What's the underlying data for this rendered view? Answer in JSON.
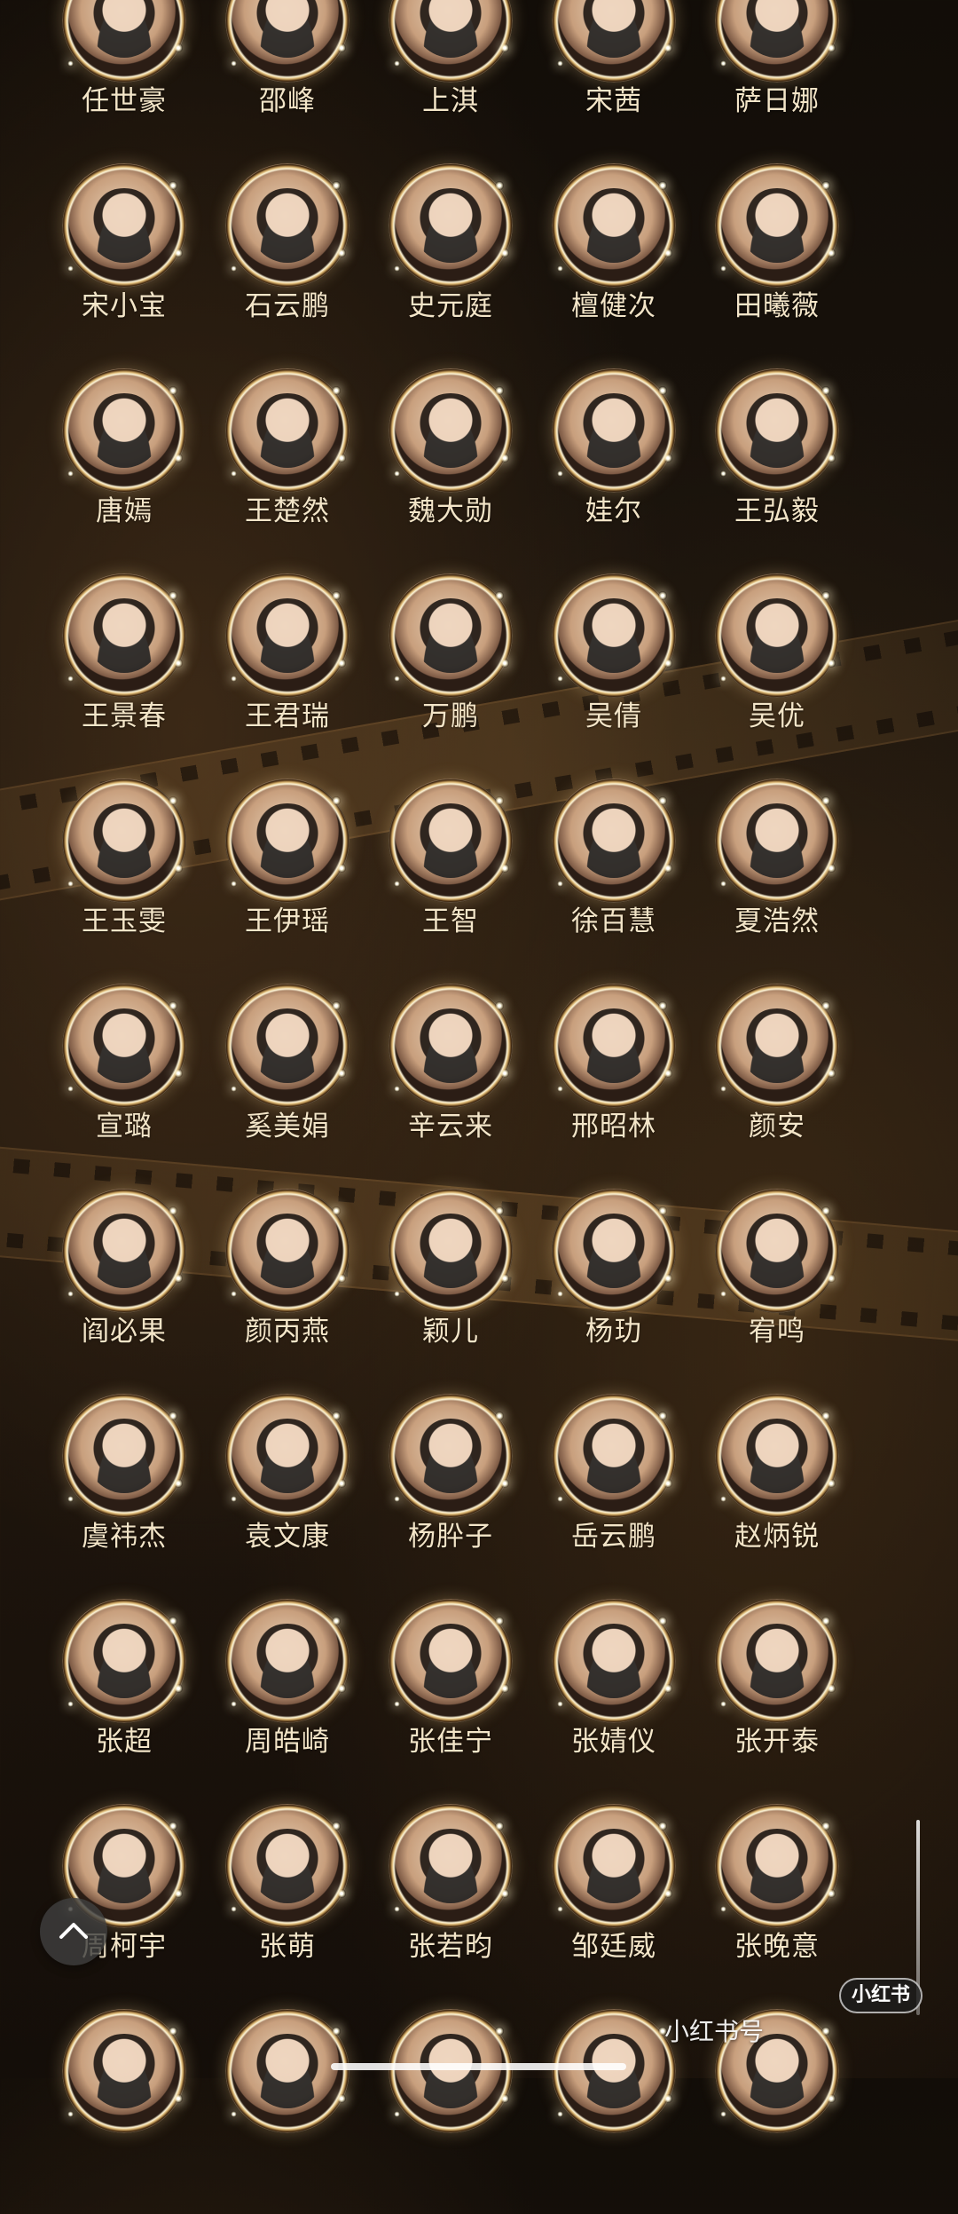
{
  "rows": [
    [
      "任世豪",
      "邵峰",
      "上淇",
      "宋茜",
      "萨日娜"
    ],
    [
      "宋小宝",
      "石云鹏",
      "史元庭",
      "檀健次",
      "田曦薇"
    ],
    [
      "唐嫣",
      "王楚然",
      "魏大勋",
      "娃尔",
      "王弘毅"
    ],
    [
      "王景春",
      "王君瑞",
      "万鹏",
      "吴倩",
      "吴优"
    ],
    [
      "王玉雯",
      "王伊瑶",
      "王智",
      "徐百慧",
      "夏浩然"
    ],
    [
      "宣璐",
      "奚美娟",
      "辛云来",
      "邢昭林",
      "颜安"
    ],
    [
      "阎必果",
      "颜丙燕",
      "颖儿",
      "杨玏",
      "宥鸣"
    ],
    [
      "虞祎杰",
      "袁文康",
      "杨肸子",
      "岳云鹏",
      "赵炳锐"
    ],
    [
      "张超",
      "周皓崎",
      "张佳宁",
      "张婧仪",
      "张开泰"
    ],
    [
      "周柯宇",
      "张萌",
      "张若昀",
      "邹廷威",
      "张晚意"
    ],
    [
      "",
      "",
      "",
      "",
      ""
    ]
  ],
  "overlay": {
    "badge_label": "小红书",
    "watermark_text": "小红书号"
  },
  "icons": {
    "back_to_top": "chevron-up-icon"
  }
}
